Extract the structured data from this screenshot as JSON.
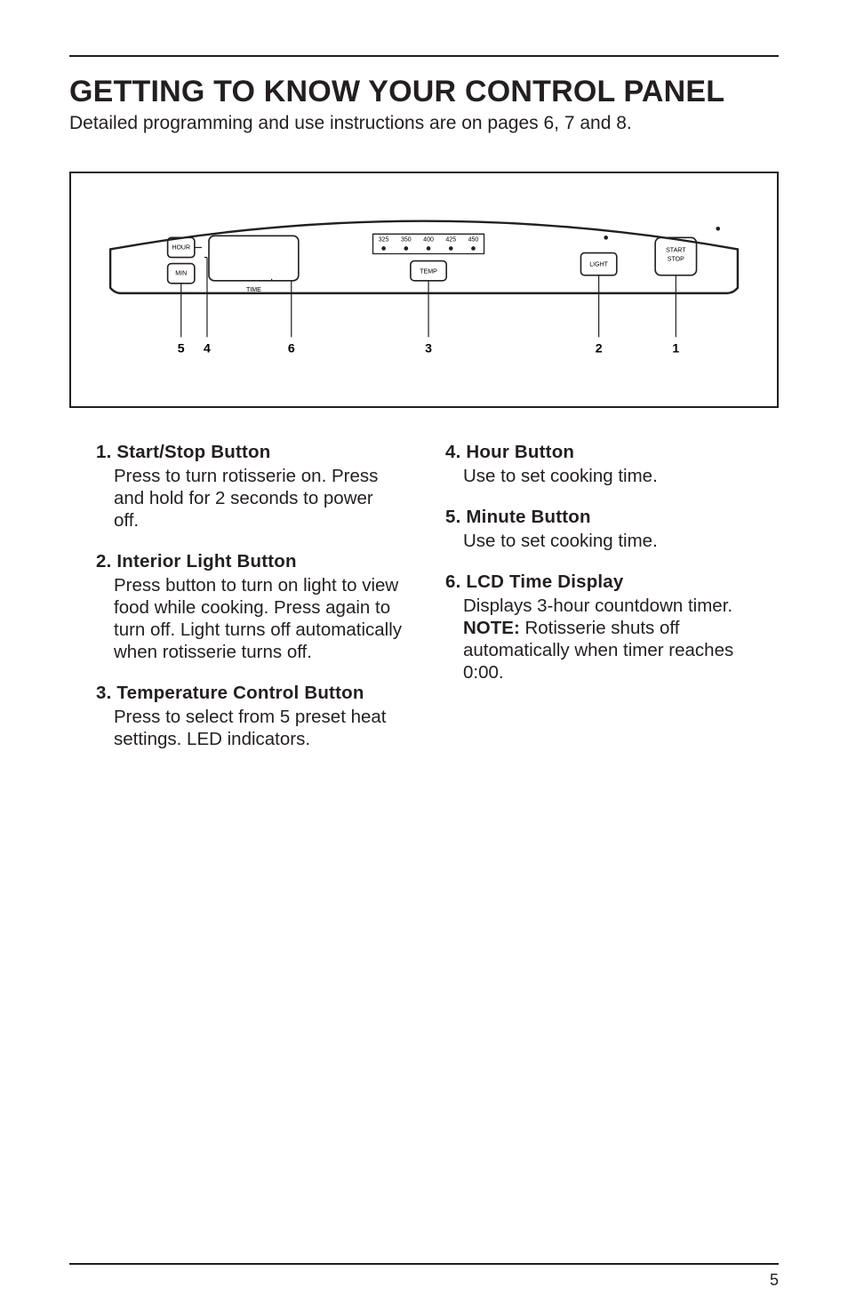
{
  "heading": "GETTING TO KNOW YOUR CONTROL PANEL",
  "subtitle": "Detailed programming and use instructions are on pages 6, 7 and 8.",
  "page_number": "5",
  "diagram": {
    "hour_label": "HOUR",
    "min_label": "MIN",
    "time_label": "TIME",
    "temp_label": "TEMP",
    "temps": [
      "325",
      "350",
      "400",
      "425",
      "450"
    ],
    "light_label": "LIGHT",
    "start_label": "START",
    "stop_label": "STOP",
    "callouts": [
      "5",
      "4",
      "6",
      "3",
      "2",
      "1"
    ]
  },
  "items_left": [
    {
      "title": "1. Start/Stop Button",
      "body": "Press to turn rotisserie on. Press and hold for 2 seconds to power off."
    },
    {
      "title": "2. Interior Light Button",
      "body": "Press button to turn on light to view food while cooking. Press again to turn off. Light turns off automatically when rotisserie turns off."
    },
    {
      "title": "3. Temperature Control Button",
      "body": "Press to select from 5 preset heat settings. LED indicators."
    }
  ],
  "items_right": [
    {
      "title": "4. Hour Button",
      "body": "Use to set cooking time."
    },
    {
      "title": "5. Minute Button",
      "body": "Use to set cooking time."
    },
    {
      "title": "6. LCD Time Display",
      "body_pre": "Displays 3-hour countdown timer.",
      "note_label": "NOTE:",
      "body_post": " Rotisserie shuts off automatically when timer reaches 0:00."
    }
  ]
}
